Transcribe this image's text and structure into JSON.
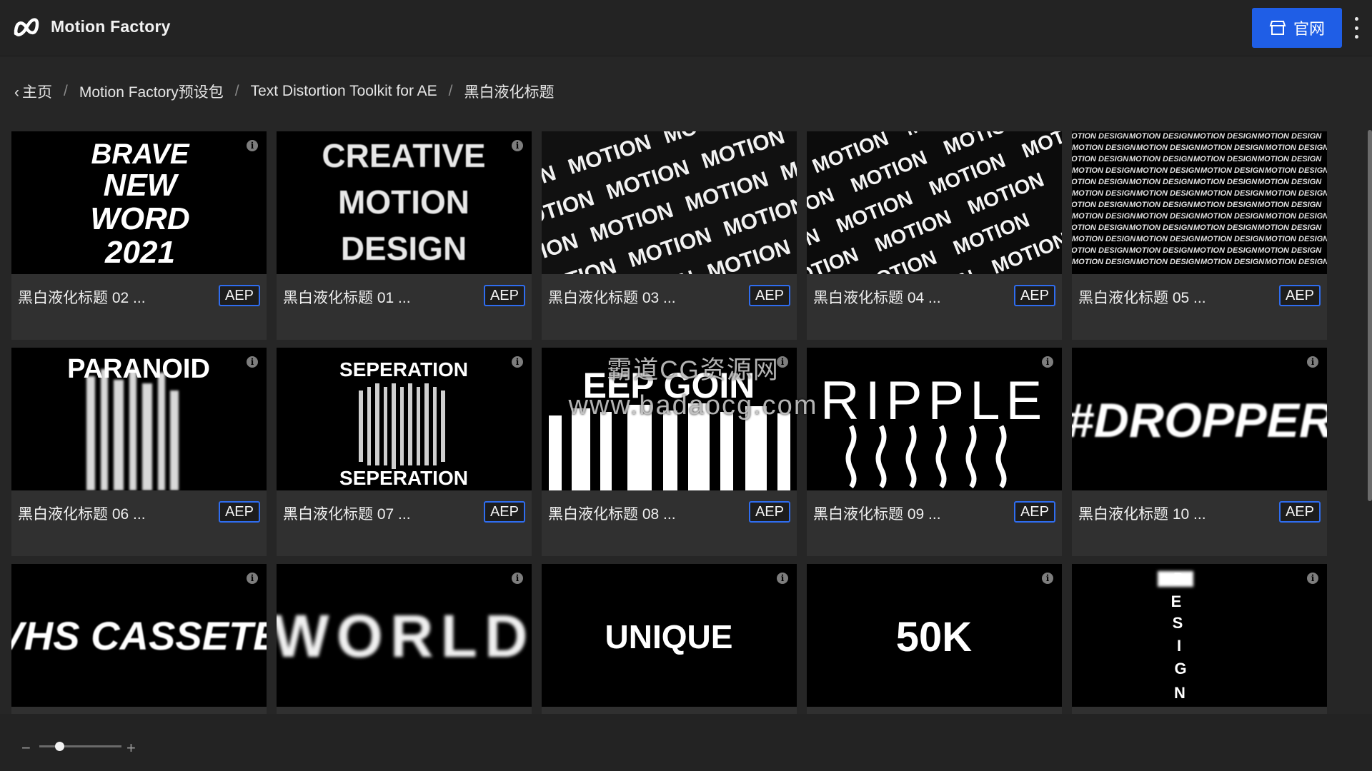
{
  "header": {
    "app_title": "Motion Factory",
    "site_button_label": "官网",
    "accent": "#1f5ee6"
  },
  "breadcrumb": {
    "items": [
      "主页",
      "Motion Factory预设包",
      "Text Distortion Toolkit for AE",
      "黑白液化标题"
    ],
    "separator": "/"
  },
  "cards": [
    {
      "title": "黑白液化标题 02 ...",
      "badge": "AEP",
      "thumb_text": [
        "BRAVE",
        "NEW",
        "WORD",
        "2021"
      ]
    },
    {
      "title": "黑白液化标题 01 ...",
      "badge": "AEP",
      "thumb_text": [
        "CREATIVE",
        "MOTION",
        "DESIGN"
      ]
    },
    {
      "title": "黑白液化标题 03 ...",
      "badge": "AEP",
      "thumb_text": [
        "MOTION"
      ]
    },
    {
      "title": "黑白液化标题 04 ...",
      "badge": "AEP",
      "thumb_text": [
        "MOTION"
      ]
    },
    {
      "title": "黑白液化标题 05 ...",
      "badge": "AEP",
      "thumb_text": [
        "MOTION DESIGN"
      ]
    },
    {
      "title": "黑白液化标题 06 ...",
      "badge": "AEP",
      "thumb_text": [
        "PARANOID"
      ]
    },
    {
      "title": "黑白液化标题 07 ...",
      "badge": "AEP",
      "thumb_text": [
        "SEPERATION",
        "SEPERATION"
      ]
    },
    {
      "title": "黑白液化标题 08 ...",
      "badge": "AEP",
      "thumb_text": [
        "EEP GOIN"
      ]
    },
    {
      "title": "黑白液化标题 09 ...",
      "badge": "AEP",
      "thumb_text": [
        "RIPPLE"
      ]
    },
    {
      "title": "黑白液化标题 10 ...",
      "badge": "AEP",
      "thumb_text": [
        "#DROPPER"
      ]
    },
    {
      "title": "",
      "badge": "",
      "thumb_text": [
        "VHS CASSETE"
      ]
    },
    {
      "title": "",
      "badge": "",
      "thumb_text": [
        "WORLD"
      ]
    },
    {
      "title": "",
      "badge": "",
      "thumb_text": [
        "UNIQUE"
      ]
    },
    {
      "title": "",
      "badge": "",
      "thumb_text": [
        "50K"
      ]
    },
    {
      "title": "",
      "badge": "",
      "thumb_text": [
        "D",
        "E",
        "S",
        "I",
        "G",
        "N"
      ]
    }
  ],
  "zoom": {
    "minus_label": "−",
    "plus_label": "+",
    "level": 0.25
  },
  "watermark": {
    "line1": "霸道CG资源网",
    "line2": "www.badaocg.com"
  }
}
